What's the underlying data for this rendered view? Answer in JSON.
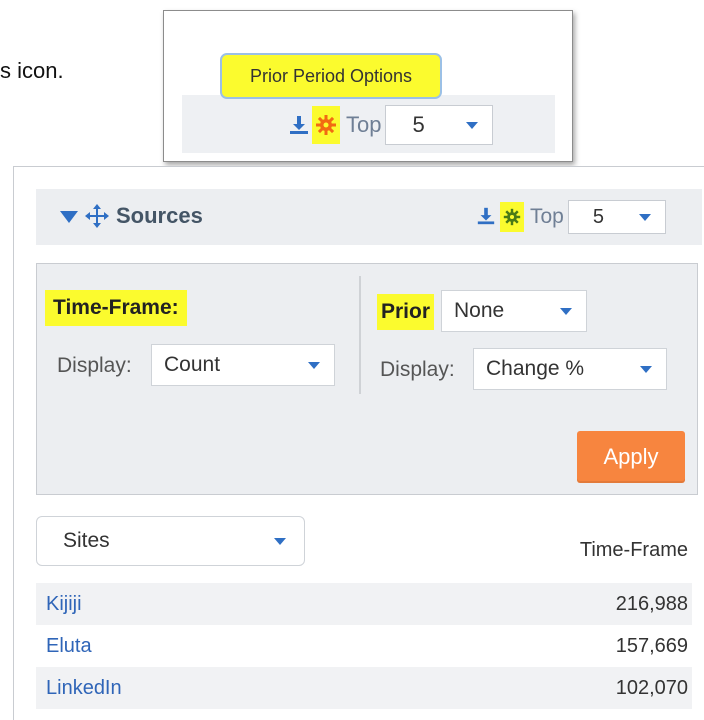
{
  "instruction_fragment": "s icon.",
  "inset": {
    "tooltip": "Prior Period Options",
    "top_label": "Top",
    "top_value": "5"
  },
  "widget": {
    "title": "Sources",
    "top_label": "Top",
    "top_value": "5",
    "options": {
      "timeframe_label": "Time-Frame:",
      "timeframe_display_label": "Display:",
      "timeframe_display_value": "Count",
      "prior_label": "Prior",
      "prior_value": "None",
      "prior_display_label": "Display:",
      "prior_display_value": "Change %",
      "apply_label": "Apply"
    },
    "sites_select": "Sites",
    "column_header": "Time-Frame",
    "rows": [
      {
        "name": "Kijiji",
        "value": "216,988"
      },
      {
        "name": "Eluta",
        "value": "157,669"
      },
      {
        "name": "LinkedIn",
        "value": "102,070"
      }
    ]
  },
  "colors": {
    "highlight": "#fbfb2e",
    "accent_blue": "#2f6fc4",
    "apply_orange": "#f7853f",
    "gear_orange": "#f26a12",
    "gear_green": "#4a7a16"
  },
  "icons": [
    "download-icon",
    "gear-icon",
    "move-icon",
    "collapse-caret-icon",
    "chevron-down-icon"
  ]
}
